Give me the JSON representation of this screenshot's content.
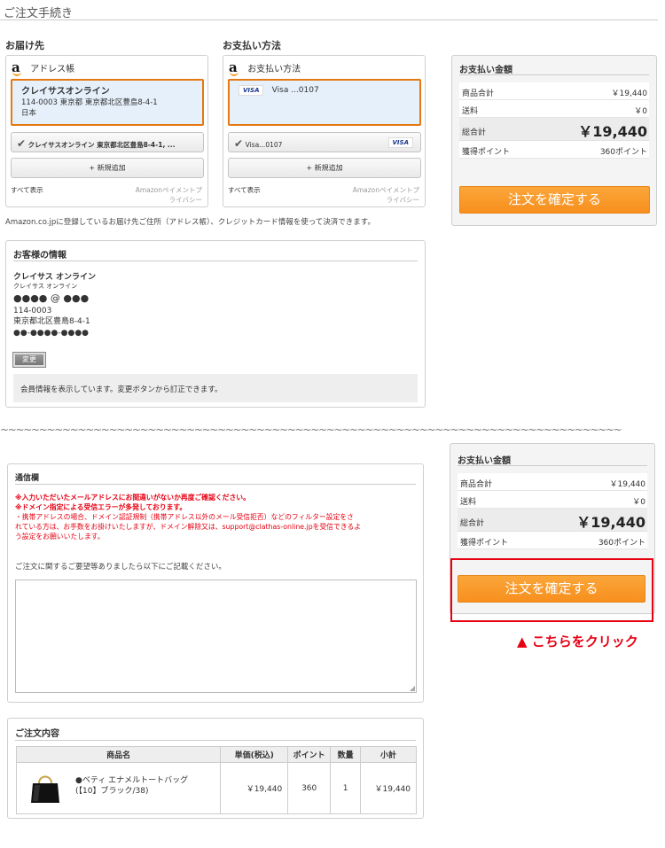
{
  "page_title": "ご注文手続き",
  "delivery": {
    "section_label": "お届け先",
    "widget_title": "アドレス帳",
    "selected_name": "クレイサスオンライン",
    "selected_address": "114-0003 東京都 東京都北区豊島8-4-1",
    "selected_country": "日本",
    "list_item": "クレイサスオンライン 東京都北区豊島8-4-1, ...",
    "add_new": "+ 新規追加",
    "show_all": "すべて表示",
    "privacy_line1": "Amazonペイメントプ",
    "privacy_line2": "ライバシー"
  },
  "payment": {
    "section_label": "お支払い方法",
    "widget_title": "お支払い方法",
    "selected_card": "Visa ...0107",
    "list_item": "Visa...0107",
    "visa_logo": "VISA",
    "add_new": "+ 新規追加",
    "show_all": "すべて表示",
    "privacy_line1": "Amazonペイメントプ",
    "privacy_line2": "ライバシー"
  },
  "amazon_note": "Amazon.co.jpに登録しているお届け先ご住所（アドレス帳）、クレジットカード情報を使って決済できます。",
  "summary": {
    "title": "お支払い金額",
    "subtotal_label": "商品合計",
    "subtotal_value": "￥19,440",
    "shipping_label": "送料",
    "shipping_value": "￥0",
    "total_label": "総合計",
    "total_value": "￥19,440",
    "points_label": "獲得ポイント",
    "points_value": "360ポイント",
    "confirm_button": "注文を確定する"
  },
  "customer": {
    "title": "お客様の情報",
    "name": "クレイサス オンライン",
    "name_kana": "クレイサス オンライン",
    "email": "●●●● @ ●●●",
    "zip": "114-0003",
    "address": "東京都北区豊島8-4-1",
    "phone": "●●-●●●●-●●●●",
    "change_button": "変更",
    "info_note": "会員情報を表示しています。変更ボタンから訂正できます。"
  },
  "divider": "~~~~~~~~~~~~~~~~~~~~~~~~~~~~~~~~~~~~~~~~~~~~~~~~~~~~~~~~~~~~~~~~~~~~~~~~~~~~~~~~",
  "message": {
    "title": "通信欄",
    "warning1": "※入力いただいたメールアドレスにお間違いがないか再度ご確認ください。",
    "warning2": "※ドメイン指定による受信エラーが多発しております。",
    "warning3_line1": "・携帯アドレスの場合、ドメイン認証規制（携帯アドレス以外のメール受信拒否）などのフィルター設定をさ",
    "warning3_line2": "れている方は、お手数をお掛けいたしますが、ドメイン解除又は、support@clathas-online.jpを受信できるよ",
    "warning3_line3": "う設定をお願いいたします。",
    "prompt": "ご注文に関するご要望等ありましたら以下にご記載ください。"
  },
  "callout": "▲ こちらをクリック",
  "order": {
    "title": "ご注文内容",
    "headers": [
      "商品名",
      "単価(税込)",
      "ポイント",
      "数量",
      "小計"
    ],
    "item_name_line1": "●ベティ エナメルトートバッグ",
    "item_name_line2": "(【10】ブラック/38)",
    "unit_price": "￥19,440",
    "points": "360",
    "quantity": "1",
    "subtotal": "￥19,440"
  }
}
